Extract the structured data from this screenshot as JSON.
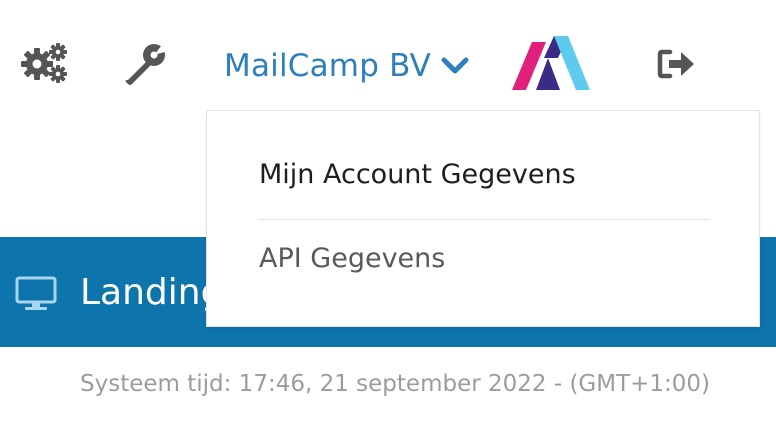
{
  "header": {
    "account_name": "MailCamp BV",
    "icons": [
      "gears-icon",
      "wrench-icon",
      "chevron-down-icon",
      "brand-logo",
      "logout-icon"
    ]
  },
  "account_menu": {
    "items": [
      {
        "label": "Mijn Account Gegevens"
      },
      {
        "label": "API Gegevens"
      }
    ]
  },
  "banner": {
    "icon": "monitor-icon",
    "title": "Landing"
  },
  "footer": {
    "system_time": "Systeem tijd: 17:46, 21 september 2022 - (GMT+1:00)"
  },
  "colors": {
    "accent": "#2e7fbd",
    "banner": "#0e74ac",
    "icon_gray": "#555555",
    "logo_pink": "#e0207a",
    "logo_purple": "#3b2b86",
    "logo_cyan": "#5ccbed"
  }
}
